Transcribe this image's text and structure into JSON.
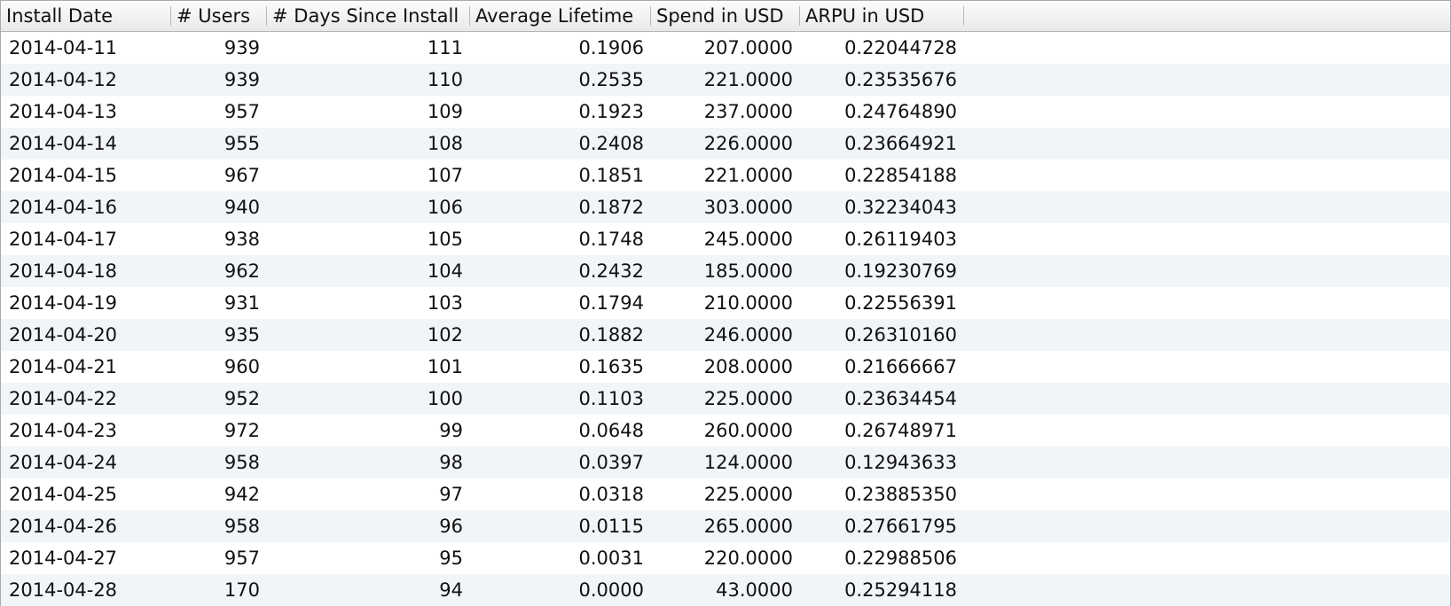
{
  "table": {
    "columns": [
      "Install Date",
      "# Users",
      "# Days Since Install",
      "Average Lifetime",
      "Spend in USD",
      "ARPU in USD"
    ],
    "rows": [
      [
        "2014-04-11",
        "939",
        "111",
        "0.1906",
        "207.0000",
        "0.22044728"
      ],
      [
        "2014-04-12",
        "939",
        "110",
        "0.2535",
        "221.0000",
        "0.23535676"
      ],
      [
        "2014-04-13",
        "957",
        "109",
        "0.1923",
        "237.0000",
        "0.24764890"
      ],
      [
        "2014-04-14",
        "955",
        "108",
        "0.2408",
        "226.0000",
        "0.23664921"
      ],
      [
        "2014-04-15",
        "967",
        "107",
        "0.1851",
        "221.0000",
        "0.22854188"
      ],
      [
        "2014-04-16",
        "940",
        "106",
        "0.1872",
        "303.0000",
        "0.32234043"
      ],
      [
        "2014-04-17",
        "938",
        "105",
        "0.1748",
        "245.0000",
        "0.26119403"
      ],
      [
        "2014-04-18",
        "962",
        "104",
        "0.2432",
        "185.0000",
        "0.19230769"
      ],
      [
        "2014-04-19",
        "931",
        "103",
        "0.1794",
        "210.0000",
        "0.22556391"
      ],
      [
        "2014-04-20",
        "935",
        "102",
        "0.1882",
        "246.0000",
        "0.26310160"
      ],
      [
        "2014-04-21",
        "960",
        "101",
        "0.1635",
        "208.0000",
        "0.21666667"
      ],
      [
        "2014-04-22",
        "952",
        "100",
        "0.1103",
        "225.0000",
        "0.23634454"
      ],
      [
        "2014-04-23",
        "972",
        "99",
        "0.0648",
        "260.0000",
        "0.26748971"
      ],
      [
        "2014-04-24",
        "958",
        "98",
        "0.0397",
        "124.0000",
        "0.12943633"
      ],
      [
        "2014-04-25",
        "942",
        "97",
        "0.0318",
        "225.0000",
        "0.23885350"
      ],
      [
        "2014-04-26",
        "958",
        "96",
        "0.0115",
        "265.0000",
        "0.27661795"
      ],
      [
        "2014-04-27",
        "957",
        "95",
        "0.0031",
        "220.0000",
        "0.22988506"
      ],
      [
        "2014-04-28",
        "170",
        "94",
        "0.0000",
        "43.0000",
        "0.25294118"
      ]
    ]
  }
}
